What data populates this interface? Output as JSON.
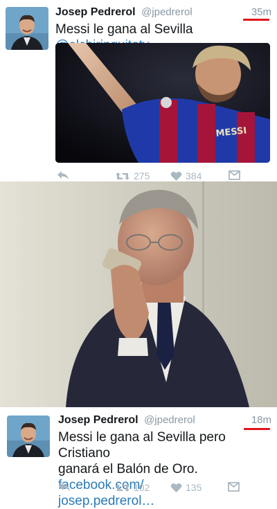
{
  "tweet_top": {
    "author_name": "Josep Pedrerol",
    "author_handle": "@jpedrerol",
    "time": "35m",
    "text": "Messi le gana al Sevilla",
    "link": "@elchiringuitotv",
    "retweets": "275",
    "likes": "384",
    "media_jersey_text": "MESSI"
  },
  "tweet_bottom": {
    "author_name": "Josep Pedrerol",
    "author_handle": "@jpedrerol",
    "time": "18m",
    "text_line1": "Messi le gana al Sevilla pero Cristiano",
    "text_line2_prefix": "ganará el Balón de Oro.",
    "link_part1": "facebook.com/",
    "link_part2": "josep.pedrerol…",
    "retweets": "102",
    "likes": "135"
  },
  "colors": {
    "accent_underline": "#e0151b",
    "link": "#2b7bb9",
    "muted": "#8899a6",
    "icon": "#aab8c2"
  },
  "icons": [
    "reply-icon",
    "retweet-icon",
    "like-icon",
    "dm-icon"
  ]
}
